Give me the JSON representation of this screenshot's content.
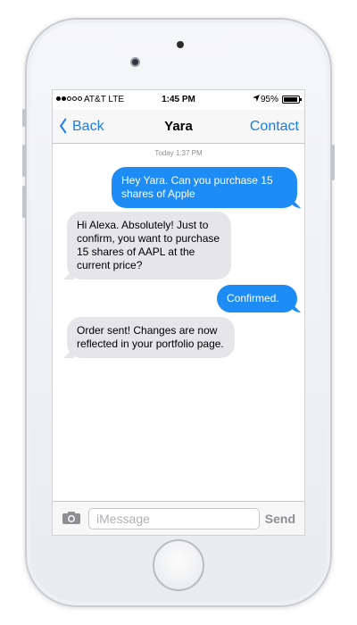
{
  "status_bar": {
    "carrier": "AT&T LTE",
    "time": "1:45 PM",
    "battery": "95%",
    "battery_level": 0.95,
    "signal_bars_filled": 2,
    "signal_bars_total": 5
  },
  "nav": {
    "back_label": "Back",
    "title": "Yara",
    "contact_label": "Contact"
  },
  "thread": {
    "timestamp": "Today 1:37 PM",
    "messages": [
      {
        "direction": "sent",
        "text": "Hey Yara. Can you purchase 15 shares of Apple"
      },
      {
        "direction": "received",
        "text": "Hi Alexa. Absolutely! Just to confirm, you want to purchase 15 shares of AAPL at the current price?"
      },
      {
        "direction": "sent",
        "text": "Confirmed."
      },
      {
        "direction": "received",
        "text": "Order sent! Changes are now reflected in your portfolio page."
      }
    ]
  },
  "composer": {
    "placeholder": "iMessage",
    "send_label": "Send"
  },
  "colors": {
    "sent_bubble": "#1e8cf5",
    "received_bubble": "#e5e5ea",
    "accent": "#1a7ee6"
  },
  "icons": [
    "location-arrow-icon",
    "battery-icon",
    "chevron-left-icon",
    "camera-icon"
  ]
}
